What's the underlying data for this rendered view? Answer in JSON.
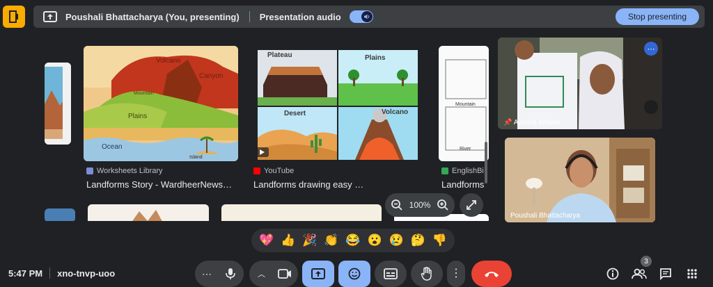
{
  "topbar": {
    "presenter": "Poushali Bhattacharya (You, presenting)",
    "audio_label": "Presentation audio",
    "stop_label": "Stop presenting"
  },
  "cards": [
    {
      "source": "Worksheets Library",
      "title": "Landforms Story - WardheerNews…",
      "labels": [
        "Volcano",
        "Canyon",
        "Mountain",
        "Plains",
        "Ocean",
        "Island"
      ]
    },
    {
      "source": "YouTube",
      "title": "Landforms drawing easy …",
      "labels": [
        "Plateau",
        "Plains",
        "Desert",
        "Volcano"
      ]
    },
    {
      "source": "EnglishBi",
      "title": "Landforms",
      "labels": [
        "Mountain",
        "River"
      ]
    }
  ],
  "zoom": {
    "level": "100%"
  },
  "participants": [
    {
      "name": "Ayesha Afsana"
    },
    {
      "name": "Poushali Bhattacharya"
    }
  ],
  "reactions": [
    "💖",
    "👍",
    "🎉",
    "👏",
    "😂",
    "😮",
    "😢",
    "🤔",
    "👎"
  ],
  "meeting": {
    "time": "5:47 PM",
    "code": "xno-tnvp-uoo"
  },
  "people_count": "3",
  "colors": {
    "accent": "#8ab4f8",
    "end_call": "#ea4335",
    "exit": "#f9ab00"
  }
}
